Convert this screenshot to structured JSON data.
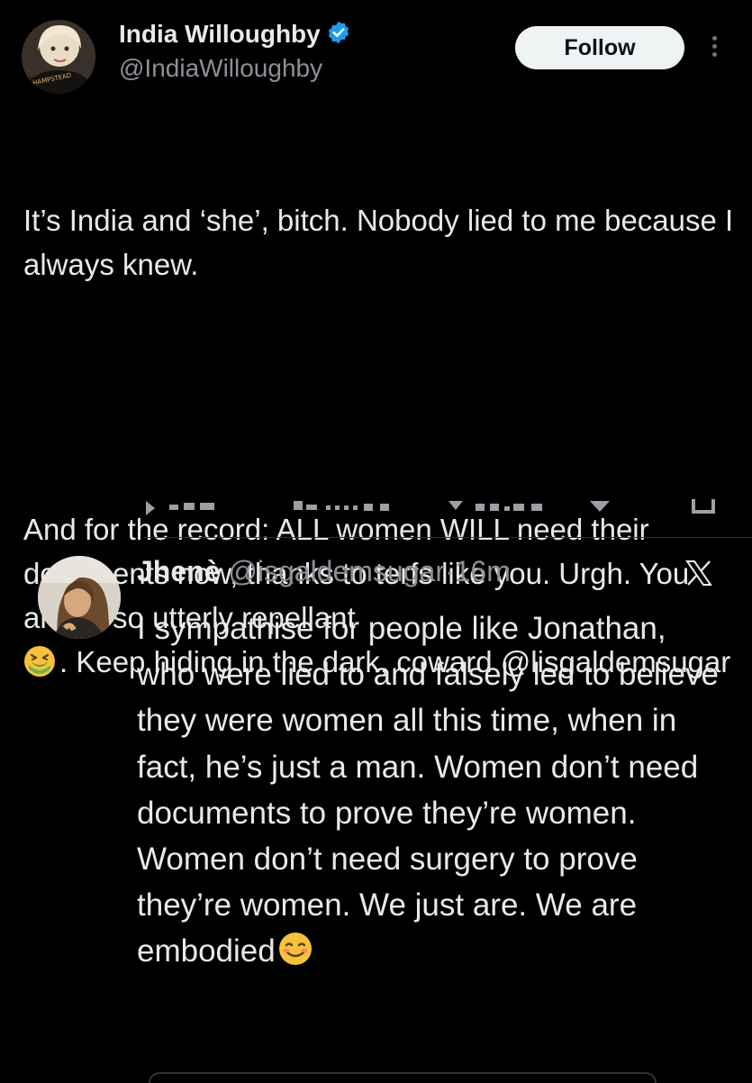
{
  "tweet": {
    "author_name": "India Willoughby",
    "author_handle": "@IndiaWilloughby",
    "follow_label": "Follow",
    "avatar_shirt_text": "HAMPSTEAD",
    "paragraphs": [
      "It’s India and ‘she’, bitch. Nobody lied to me because I always knew.",
      "And for the record: ALL women WILL need their documents now, thanks to terfs like you. Urgh. You are all so utterly repellant",
      ". Keep hiding in the dark, coward @lisgaldemsugar"
    ]
  },
  "quoted": {
    "author_name": "Jhenè",
    "author_handle": "@isgaldemsugar",
    "separator": "·",
    "time": "16m",
    "text": "I sympathise for people like Jonathan, who were lied to and falsely led to believe they were women all this time, when in fact, he’s just a man. Women don’t need documents to prove they’re women. Women don’t need surgery to prove they’re women. We just are. We are embodied"
  },
  "icons": {
    "verified": "verified-badge-icon",
    "more": "more-options-icon",
    "nauseated_emoji": "nauseated-face-emoji",
    "smiling_emoji": "smiling-face-emoji",
    "x_logo": "x-logo-icon"
  },
  "colors": {
    "background": "#000000",
    "text_primary": "#e7e9ea",
    "text_secondary": "#8b9096",
    "verified_blue": "#1d9bf0",
    "follow_bg": "#eff3f4"
  }
}
